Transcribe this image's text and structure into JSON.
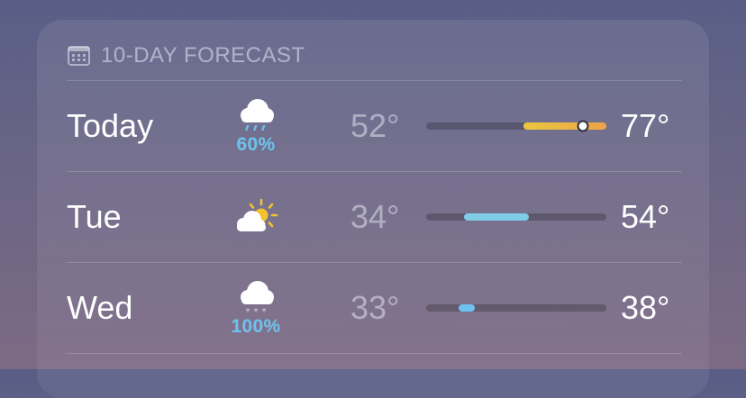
{
  "forecast": {
    "header": {
      "icon": "calendar-icon",
      "title": "10-DAY FORECAST"
    },
    "days": [
      {
        "day": "Today",
        "icon": "cloud-rain-icon",
        "precip": "60%",
        "low": "52°",
        "high": "77°",
        "range": {
          "start": 0.54,
          "end": 1.0
        },
        "current": 0.87,
        "colors": [
          "#e9c83f",
          "#f0a24a"
        ]
      },
      {
        "day": "Tue",
        "icon": "cloud-sun-icon",
        "precip": "",
        "low": "34°",
        "high": "54°",
        "range": {
          "start": 0.21,
          "end": 0.57
        },
        "current": null,
        "colors": [
          "#7fcde6",
          "#7fcde6"
        ]
      },
      {
        "day": "Wed",
        "icon": "cloud-snow-icon",
        "precip": "100%",
        "low": "33°",
        "high": "38°",
        "range": {
          "start": 0.18,
          "end": 0.27
        },
        "current": null,
        "colors": [
          "#6cc3ef",
          "#6cc3ef"
        ]
      }
    ]
  }
}
